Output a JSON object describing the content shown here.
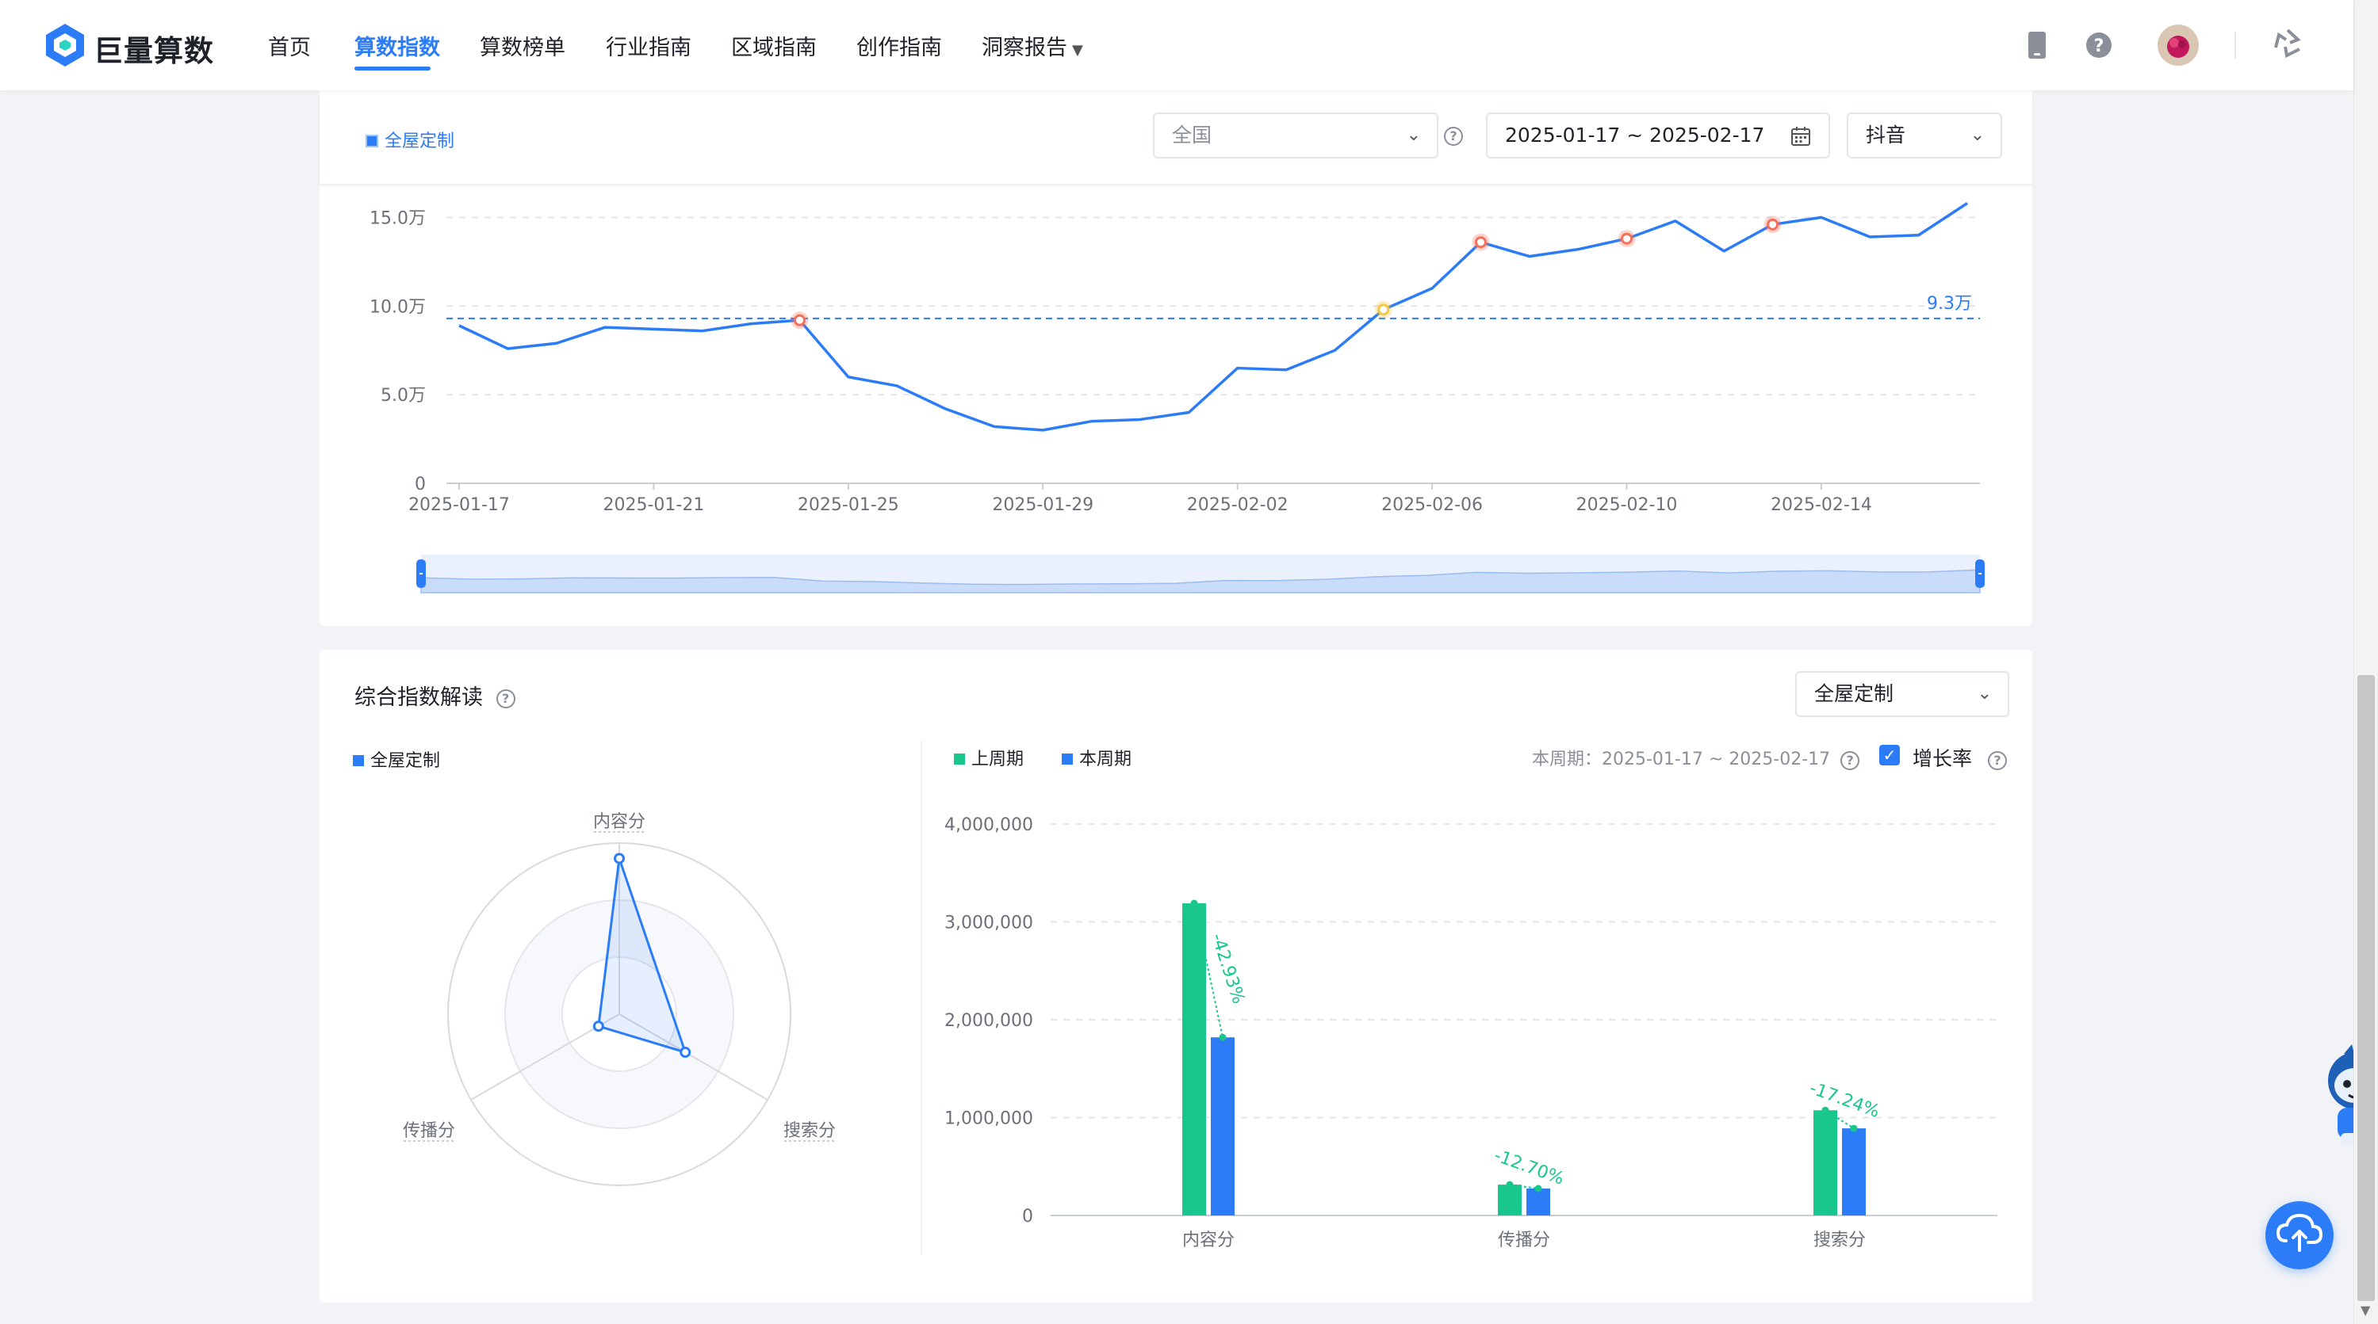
{
  "brand": {
    "name": "巨量算数"
  },
  "nav": {
    "items": [
      "首页",
      "算数指数",
      "算数榜单",
      "行业指南",
      "区域指南",
      "创作指南",
      "洞察报告"
    ],
    "active": "算数指数"
  },
  "filters": {
    "keyword_tag": "全屋定制",
    "region_placeholder": "全国",
    "date_range": "2025-01-17 ~ 2025-02-17",
    "platform": "抖音"
  },
  "chart_data": [
    {
      "type": "line",
      "y_tick_labels": [
        "0",
        "5.0万",
        "10.0万",
        "15.0万"
      ],
      "ylim": [
        0,
        160000
      ],
      "x_tick_labels": [
        "2025-01-17",
        "2025-01-21",
        "2025-01-25",
        "2025-01-29",
        "2025-02-02",
        "2025-02-06",
        "2025-02-10",
        "2025-02-14"
      ],
      "x": [
        "2025-01-17",
        "2025-01-18",
        "2025-01-19",
        "2025-01-20",
        "2025-01-21",
        "2025-01-22",
        "2025-01-23",
        "2025-01-24",
        "2025-01-25",
        "2025-01-26",
        "2025-01-27",
        "2025-01-28",
        "2025-01-29",
        "2025-01-30",
        "2025-01-31",
        "2025-02-01",
        "2025-02-02",
        "2025-02-03",
        "2025-02-04",
        "2025-02-05",
        "2025-02-06",
        "2025-02-07",
        "2025-02-08",
        "2025-02-09",
        "2025-02-10",
        "2025-02-11",
        "2025-02-12",
        "2025-02-13",
        "2025-02-14",
        "2025-02-15",
        "2025-02-16",
        "2025-02-17"
      ],
      "series": [
        {
          "values": [
            89000,
            76000,
            79000,
            88000,
            87000,
            86000,
            90000,
            92000,
            60000,
            55000,
            42000,
            32000,
            30000,
            35000,
            36000,
            40000,
            65000,
            64000,
            75000,
            98000,
            110000,
            136000,
            128000,
            132000,
            138000,
            148000,
            131000,
            146000,
            150000,
            139000,
            140000,
            158000
          ],
          "color": "#2b7cf6"
        }
      ],
      "average_line": {
        "value": 93000,
        "label": "9.3万"
      },
      "marked_points": [
        {
          "x": "2025-01-24",
          "color": "#f5705a"
        },
        {
          "x": "2025-02-05",
          "color": "#f5c842"
        },
        {
          "x": "2025-02-07",
          "color": "#f5705a"
        },
        {
          "x": "2025-02-10",
          "color": "#f5705a"
        },
        {
          "x": "2025-02-13",
          "color": "#f5705a"
        }
      ],
      "grid": true
    },
    {
      "type": "radar",
      "legend": [
        "全屋定制"
      ],
      "axes": [
        "内容分",
        "搜索分",
        "传播分"
      ],
      "values": [
        1820000,
        890000,
        280000
      ],
      "max": 2000000,
      "color": "#2b7cf6"
    },
    {
      "type": "bar",
      "categories": [
        "内容分",
        "传播分",
        "搜索分"
      ],
      "series": [
        {
          "name": "上周期",
          "values": [
            3190000,
            315000,
            1075000
          ],
          "color": "#19c68c"
        },
        {
          "name": "本周期",
          "values": [
            1820000,
            275000,
            890000
          ],
          "color": "#2b7cf6"
        }
      ],
      "growth_labels": [
        "-42.93%",
        "-12.70%",
        "-17.24%"
      ],
      "y_tick_labels": [
        "0",
        "1,000,000",
        "2,000,000",
        "3,000,000",
        "4,000,000"
      ],
      "ylim": [
        0,
        4000000
      ],
      "grid": true
    }
  ],
  "insight": {
    "title": "综合指数解读",
    "keyword_select": "全屋定制",
    "period_text": "本周期：2025-01-17 ~ 2025-02-17",
    "growth_toggle_label": "增长率",
    "growth_toggle_checked": true
  },
  "colors": {
    "accent": "#2b7cf6",
    "green": "#19c68c",
    "marker_red": "#f5705a",
    "marker_yellow": "#f5c842"
  }
}
